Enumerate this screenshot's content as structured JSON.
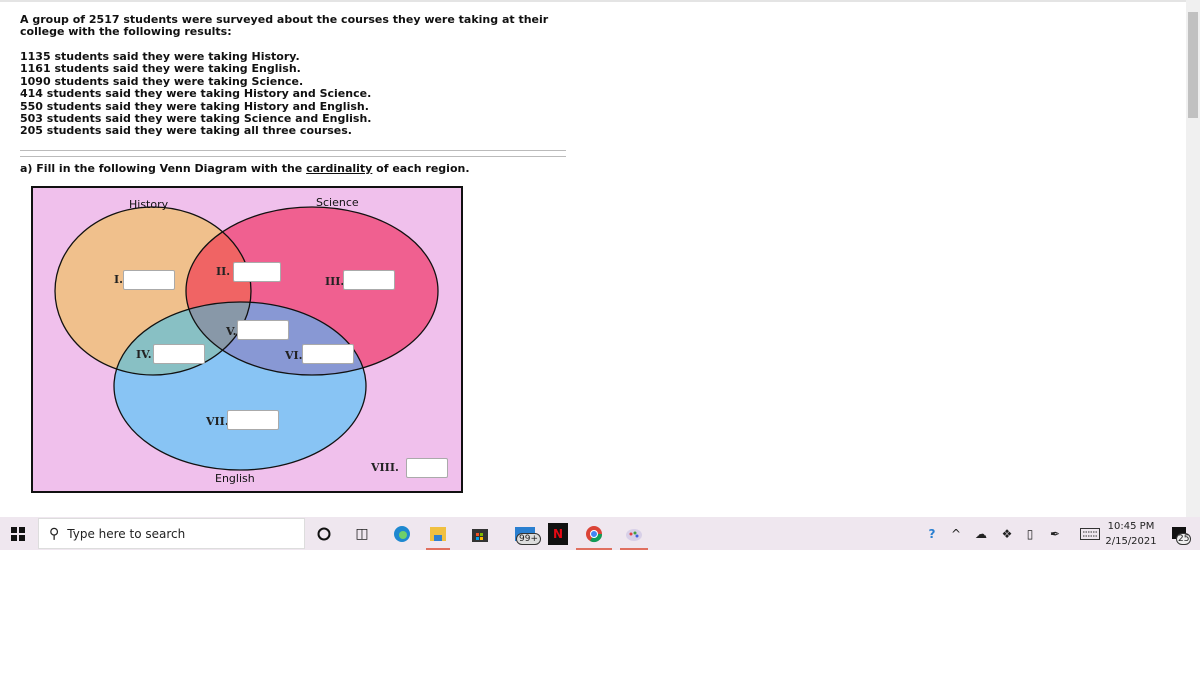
{
  "problem": {
    "intro": "A group of 2517 students were surveyed about the courses they were taking at their college with the following results:",
    "facts": [
      "1135 students said they were taking History.",
      "1161 students said they were taking English.",
      "1090 students said they were taking Science.",
      "414 students said they were taking History and Science.",
      "550 students said they were taking History and English.",
      "503 students said they were taking Science and English.",
      "205 students said they were taking all three courses."
    ],
    "question_prefix": "a) Fill in the following Venn Diagram with the ",
    "question_link": "cardinality",
    "question_suffix": " of each region."
  },
  "venn": {
    "sets": {
      "history": "History",
      "science": "Science",
      "english": "English"
    },
    "regions": [
      {
        "label": "I.",
        "value": ""
      },
      {
        "label": "II.",
        "value": ""
      },
      {
        "label": "III.",
        "value": ""
      },
      {
        "label": "IV.",
        "value": ""
      },
      {
        "label": "V.",
        "value": ""
      },
      {
        "label": "VI.",
        "value": ""
      },
      {
        "label": "VII.",
        "value": ""
      },
      {
        "label": "VIII.",
        "value": ""
      }
    ],
    "colors": {
      "background": "#f0c0ec",
      "history": "#f0c08c",
      "science": "#f06090",
      "english": "#88c4f4",
      "history_science": "#f06464",
      "history_english": "#88c0c4",
      "science_english": "#8898d4",
      "all": "#8898a8"
    }
  },
  "taskbar": {
    "search_placeholder": "Type here to search",
    "mail_badge": "99+",
    "time": "10:45 PM",
    "date": "2/15/2021",
    "notification_count": "25"
  }
}
